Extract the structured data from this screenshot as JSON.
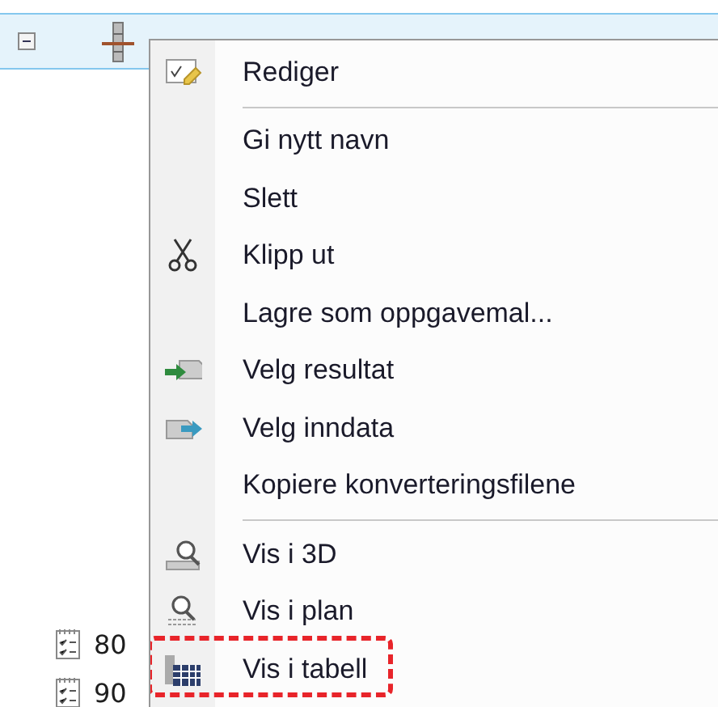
{
  "tree": {
    "root": {
      "expanded": true,
      "selected": true
    },
    "children": [
      {
        "label": "80"
      },
      {
        "label": "90"
      }
    ]
  },
  "context_menu": {
    "items": [
      {
        "kind": "item",
        "label": "Rediger",
        "highlighted": false
      },
      {
        "kind": "separator"
      },
      {
        "kind": "item",
        "label": "Gi nytt navn",
        "highlighted": false
      },
      {
        "kind": "item",
        "label": "Slett",
        "highlighted": false
      },
      {
        "kind": "item",
        "label": "Klipp ut",
        "highlighted": false
      },
      {
        "kind": "item",
        "label": "Lagre som oppgavemal...",
        "highlighted": false
      },
      {
        "kind": "item",
        "label": "Velg resultat",
        "highlighted": false
      },
      {
        "kind": "item",
        "label": "Velg inndata",
        "highlighted": false
      },
      {
        "kind": "item",
        "label": "Kopiere konverteringsfilene",
        "highlighted": false
      },
      {
        "kind": "separator"
      },
      {
        "kind": "item",
        "label": "Vis i 3D",
        "highlighted": false
      },
      {
        "kind": "item",
        "label": "Vis i plan",
        "highlighted": false
      },
      {
        "kind": "item",
        "label": "Vis i tabell",
        "highlighted": true
      }
    ]
  }
}
